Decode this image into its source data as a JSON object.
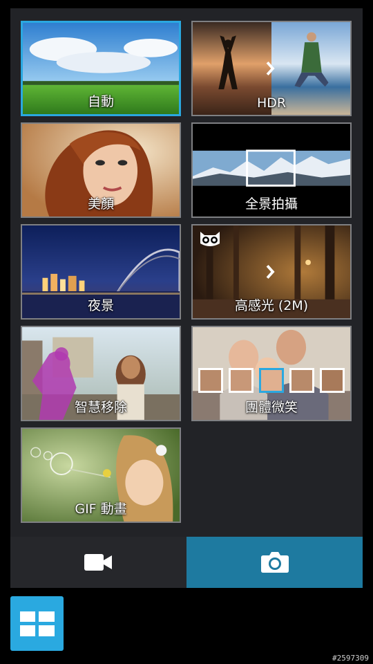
{
  "modes": [
    {
      "id": "auto",
      "label": "自動",
      "selected": true
    },
    {
      "id": "hdr",
      "label": "HDR",
      "selected": false
    },
    {
      "id": "beautification",
      "label": "美顏",
      "selected": false
    },
    {
      "id": "panorama",
      "label": "全景拍攝",
      "selected": false
    },
    {
      "id": "night",
      "label": "夜景",
      "selected": false
    },
    {
      "id": "low-light",
      "label": "高感光 (2M)",
      "selected": false
    },
    {
      "id": "smart-remove",
      "label": "智慧移除",
      "selected": false
    },
    {
      "id": "all-smiles",
      "label": "團體微笑",
      "selected": false
    },
    {
      "id": "gif-animation",
      "label": "GIF 動畫",
      "selected": false
    }
  ],
  "bottom_bar": {
    "video_icon": "video-camera-icon",
    "photo_icon": "camera-icon",
    "active": "photo"
  },
  "grid_button_icon": "grid-icon",
  "watermark": "#2597309",
  "colors": {
    "accent": "#2aa9e0",
    "photo_active": "#1e7aa0",
    "panel": "#222327"
  }
}
